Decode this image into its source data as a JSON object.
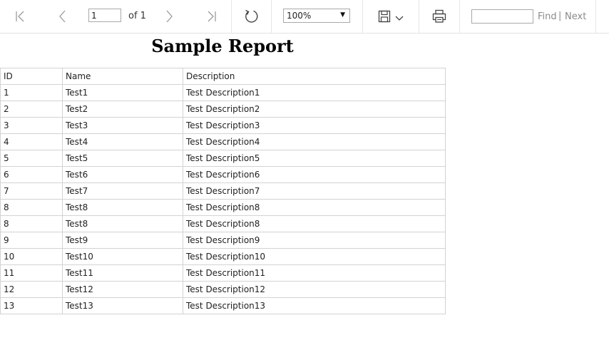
{
  "toolbar": {
    "page_current": "1",
    "page_of": "of 1",
    "zoom": "100%",
    "find_label": "Find",
    "find_separator": "|",
    "next_label": "Next"
  },
  "report": {
    "title": "Sample Report",
    "columns": [
      "ID",
      "Name",
      "Description"
    ],
    "rows": [
      [
        "1",
        "Test1",
        "Test Description1"
      ],
      [
        "2",
        "Test2",
        "Test Description2"
      ],
      [
        "3",
        "Test3",
        "Test Description3"
      ],
      [
        "4",
        "Test4",
        "Test Description4"
      ],
      [
        "5",
        "Test5",
        "Test Description5"
      ],
      [
        "6",
        "Test6",
        "Test Description6"
      ],
      [
        "7",
        "Test7",
        "Test Description7"
      ],
      [
        "8",
        "Test8",
        "Test Description8"
      ],
      [
        "8",
        "Test8",
        "Test Description8"
      ],
      [
        "9",
        "Test9",
        "Test Description9"
      ],
      [
        "10",
        "Test10",
        "Test Description10"
      ],
      [
        "11",
        "Test11",
        "Test Description11"
      ],
      [
        "12",
        "Test12",
        "Test Description12"
      ],
      [
        "13",
        "Test13",
        "Test Description13"
      ]
    ]
  }
}
